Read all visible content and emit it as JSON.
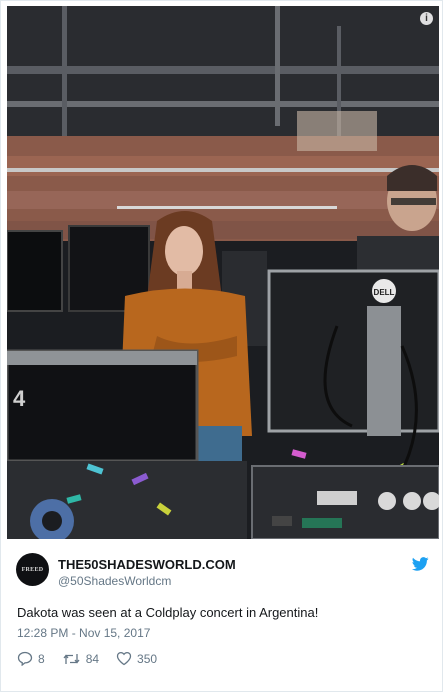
{
  "photo": {
    "alt": "",
    "info_icon": "info-icon",
    "brand_logo": "DELL"
  },
  "tweet": {
    "avatar_text": "FREED",
    "display_name": "THE50SHADESWORLD.COM",
    "handle": "@50ShadesWorldcm",
    "text": "Dakota was seen at a Coldplay concert in Argentina!",
    "timestamp": "12:28 PM - Nov 15, 2017",
    "actions": {
      "reply_icon": "reply-icon",
      "reply_count": "8",
      "retweet_icon": "retweet-icon",
      "retweet_count": "84",
      "like_icon": "heart-icon",
      "like_count": "350"
    },
    "brand_icon": "twitter-bird-icon",
    "colors": {
      "name": "#14171a",
      "secondary": "#657786",
      "twitter_blue": "#1da1f2"
    }
  }
}
